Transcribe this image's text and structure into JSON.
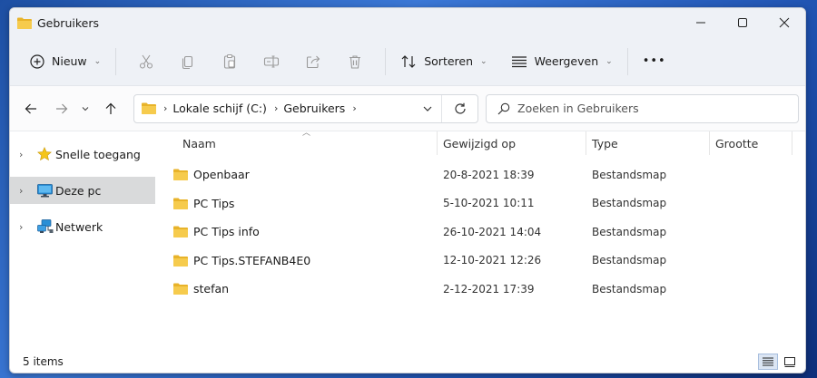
{
  "window": {
    "title": "Gebruikers"
  },
  "toolbar": {
    "new_label": "Nieuw",
    "sort_label": "Sorteren",
    "view_label": "Weergeven",
    "more_label": "•••"
  },
  "address": {
    "crumbs": [
      "Lokale schijf (C:)",
      "Gebruikers"
    ],
    "search_placeholder": "Zoeken in Gebruikers"
  },
  "sidebar": {
    "items": [
      {
        "label": "Snelle toegang",
        "icon": "star-icon"
      },
      {
        "label": "Deze pc",
        "icon": "monitor-icon",
        "selected": true
      },
      {
        "label": "Netwerk",
        "icon": "network-icon"
      }
    ]
  },
  "columns": {
    "name": "Naam",
    "date": "Gewijzigd op",
    "type": "Type",
    "size": "Grootte"
  },
  "files": [
    {
      "name": "Openbaar",
      "date": "20-8-2021 18:39",
      "type": "Bestandsmap"
    },
    {
      "name": "PC Tips",
      "date": "5-10-2021 10:11",
      "type": "Bestandsmap"
    },
    {
      "name": "PC Tips info",
      "date": "26-10-2021 14:04",
      "type": "Bestandsmap"
    },
    {
      "name": "PC Tips.STEFANB4E0",
      "date": "12-10-2021 12:26",
      "type": "Bestandsmap"
    },
    {
      "name": "stefan",
      "date": "2-12-2021 17:39",
      "type": "Bestandsmap"
    }
  ],
  "status": {
    "items_count": "5 items"
  },
  "colors": {
    "folder": "#f4c542",
    "accent": "#0067c0"
  }
}
